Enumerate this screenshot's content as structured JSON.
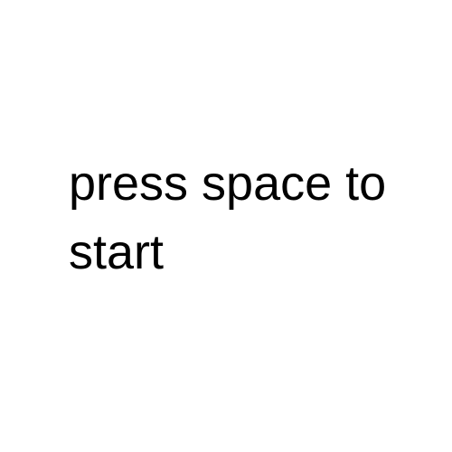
{
  "game": {
    "start_prompt": "press space to start"
  },
  "colors": {
    "background": "#ffffff",
    "text": "#000000"
  }
}
